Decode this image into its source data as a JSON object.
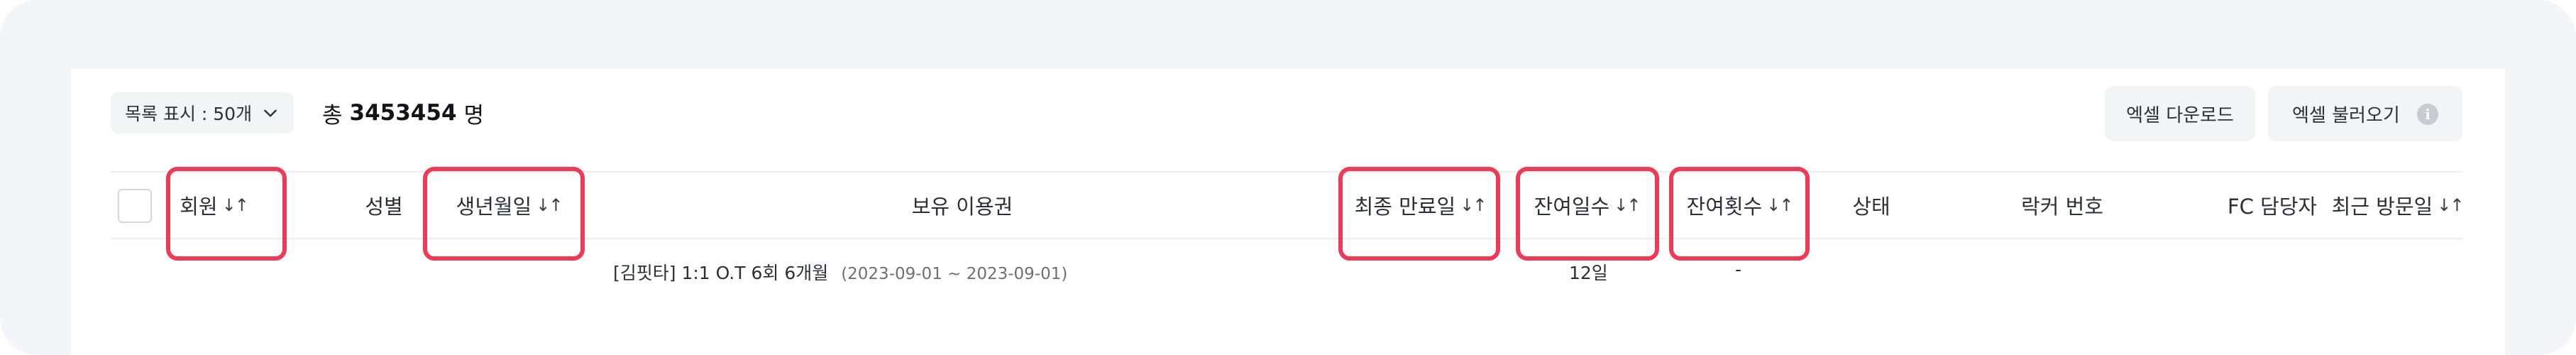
{
  "toolbar": {
    "list_display": "목록 표시 : 50개",
    "total_prefix": "총",
    "total_count": "3453454",
    "total_unit": "명",
    "excel_download": "엑셀 다운로드",
    "excel_upload": "엑셀 불러오기",
    "info_icon_glyph": "i"
  },
  "table": {
    "sort_glyph": "↓↑",
    "columns": {
      "member": "회원",
      "gender": "성별",
      "birthdate": "생년월일",
      "tickets": "보유 이용권",
      "last_expiry": "최종 만료일",
      "remaining_days": "잔여일수",
      "remaining_count": "잔여횟수",
      "status": "상태",
      "locker": "락커 번호",
      "fc_manager": "FC 담당자",
      "last_visit": "최근 방문일"
    },
    "rows": [
      {
        "ticket_name": "[김핏타] 1:1 O.T 6회 6개월",
        "ticket_period": "(2023-09-01 ~ 2023-09-01)",
        "remaining_days": "12일",
        "remaining_count": "-"
      }
    ]
  },
  "colors": {
    "highlight": "#ee3a56",
    "background": "#f4f5f8",
    "button_bg": "#f3f4f6"
  }
}
